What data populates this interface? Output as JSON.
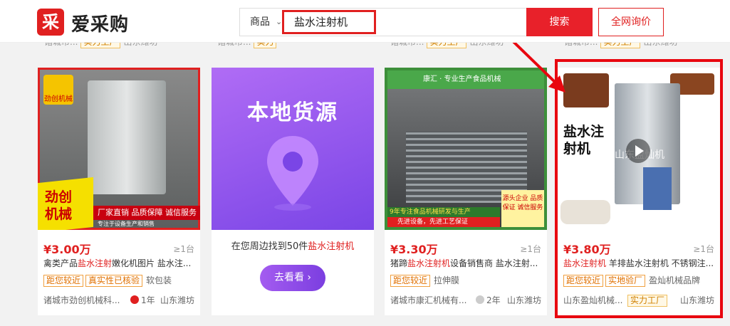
{
  "header": {
    "logo_mark": "采",
    "logo_text": "爱采购",
    "search_category": "商品",
    "search_value": "盐水注射机",
    "search_button": "搜索",
    "inquiry_button": "全网询价"
  },
  "prev_row": [
    {
      "shop": "诸城市...",
      "tag": "实力工厂",
      "loc": "山东潍坊"
    },
    {
      "shop": "诸城市...",
      "tag": "实力"
    },
    {
      "shop": "诸城市...",
      "tag": "实力工厂",
      "loc": "山东潍坊"
    },
    {
      "shop": "诸城市...",
      "tag": "实力工厂",
      "loc": "山东潍坊"
    }
  ],
  "cards": [
    {
      "image_text_1": "劲创",
      "image_text_2": "机械",
      "image_banner": "厂家直销  品质保障  诚信服务",
      "image_sub": "专注于设备生产和销售",
      "image_logo": "劲创机械",
      "price": "¥3.00万",
      "moq": "≥1台",
      "title_pre": "禽类产品",
      "title_hl": "盐水注射",
      "title_post": "嫩化机图片 盐水注...",
      "tag1": "距您较近",
      "tag2": "真实性已核验",
      "plain": "软包装",
      "shop": "诸城市劲创机械科...",
      "age": "1年",
      "loc": "山东潍坊"
    },
    {
      "banner_title": "本地货源",
      "text_pre": "在您周边找到50件",
      "text_hl": "盐水注射机",
      "button": "去看看 ›"
    },
    {
      "image_logo": "康汇 · 专业生产食品机械",
      "image_caption": "9年专注食品机械研发与生产",
      "image_caption2": "先进设备，先进工艺保证",
      "image_side": "源头企业 品质保证 诚信服务",
      "price": "¥3.30万",
      "moq": "≥1台",
      "title_pre": "猪蹄",
      "title_hl": "盐水注射机",
      "title_post": "设备销售商 盐水注射...",
      "tag1": "距您较近",
      "plain": "拉伸膜",
      "shop": "诸城市康汇机械有...",
      "age": "2年",
      "loc": "山东潍坊"
    },
    {
      "image_label": "盐水注射机",
      "image_watermark": "山东盈灿机",
      "price": "¥3.80万",
      "moq": "≥1台",
      "title_hl": "盐水注射机",
      "title_post": " 羊排盐水注射机 不锈钢注...",
      "tag1": "距您较近",
      "tag2": "实地验厂",
      "plain": "盈灿机械品牌",
      "shop": "山东盈灿机械...",
      "strength": "实力工厂",
      "loc": "山东潍坊"
    }
  ],
  "colors": {
    "accent": "#e02020",
    "annotation": "#e8070f",
    "purple": "#8a4ce8"
  }
}
